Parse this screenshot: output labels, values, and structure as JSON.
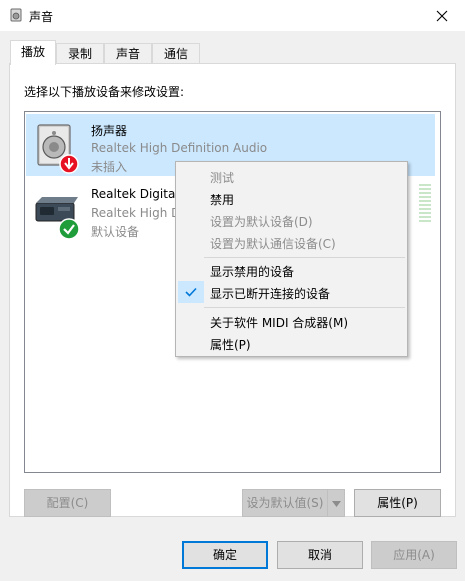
{
  "window": {
    "title": "声音"
  },
  "tabs": [
    {
      "label": "播放",
      "active": true
    },
    {
      "label": "录制",
      "active": false
    },
    {
      "label": "声音",
      "active": false
    },
    {
      "label": "通信",
      "active": false
    }
  ],
  "instruction": "选择以下播放设备来修改设置:",
  "devices": [
    {
      "name": "扬声器",
      "description": "Realtek High Definition Audio",
      "status": "未插入",
      "icon": "speaker-icon",
      "badge": "down-arrow-disconnected-icon",
      "selected": true
    },
    {
      "name": "Realtek Digital",
      "description": "Realtek High D",
      "status": "默认设备",
      "icon": "digital-output-icon",
      "badge": "default-check-icon",
      "selected": false
    }
  ],
  "context_menu": {
    "items": [
      {
        "label": "测试",
        "enabled": false
      },
      {
        "label": "禁用",
        "enabled": true
      },
      {
        "label": "设置为默认设备(D)",
        "enabled": false
      },
      {
        "label": "设置为默认通信设备(C)",
        "enabled": false
      },
      {
        "label": "显示禁用的设备",
        "enabled": true
      },
      {
        "label": "显示已断开连接的设备",
        "enabled": true,
        "checked": true
      },
      {
        "label": "关于软件 MIDI 合成器(M)",
        "enabled": true
      },
      {
        "label": "属性(P)",
        "enabled": true
      }
    ]
  },
  "panel_buttons": {
    "configure": "配置(C)",
    "set_default": "设为默认值(S)",
    "properties": "属性(P)"
  },
  "dialog_buttons": {
    "ok": "确定",
    "cancel": "取消",
    "apply": "应用(A)"
  },
  "colors": {
    "selection": "#cce8ff",
    "accent": "#0078d7",
    "check_green": "#1f9d3a",
    "disconnect_red": "#e81123"
  }
}
